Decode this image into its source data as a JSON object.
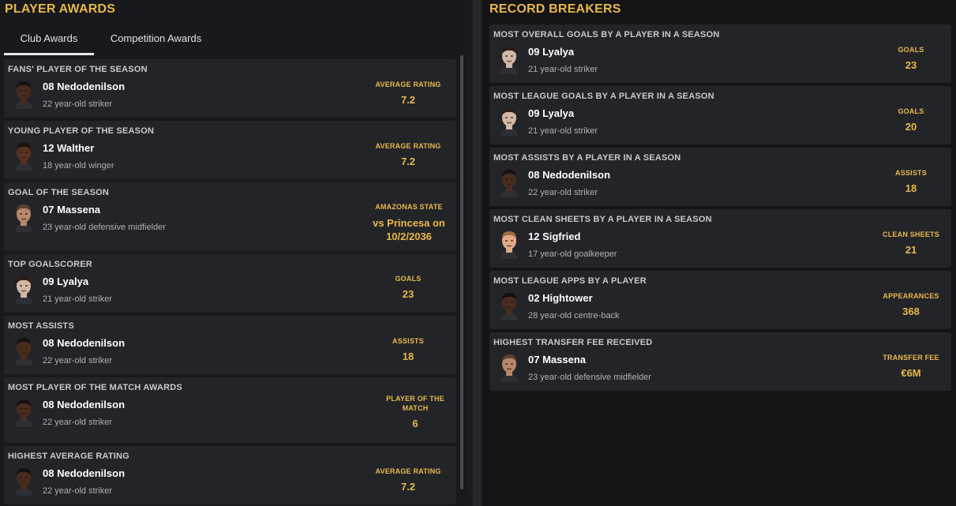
{
  "left": {
    "title": "PLAYER AWARDS",
    "tabs": [
      {
        "label": "Club Awards",
        "active": true
      },
      {
        "label": "Competition Awards",
        "active": false
      }
    ],
    "awards": [
      {
        "title": "FANS' PLAYER OF THE SEASON",
        "name": "08 Nedodenilson",
        "desc": "22 year-old striker",
        "stat_label": "AVERAGE RATING",
        "stat_value": "7.2",
        "skin": "#4a2c1e",
        "hair": "#151010"
      },
      {
        "title": "YOUNG PLAYER OF THE SEASON",
        "name": "12 Walther",
        "desc": "18 year-old winger",
        "stat_label": "AVERAGE RATING",
        "stat_value": "7.2",
        "skin": "#5a3220",
        "hair": "#1a1210"
      },
      {
        "title": "GOAL OF THE SEASON",
        "name": "07 Massena",
        "desc": "23 year-old defensive midfielder",
        "stat_label": "AMAZONAS STATE",
        "stat_value": "vs Princesa on 10/2/2036",
        "skin": "#b8876a",
        "hair": "#5a4030"
      },
      {
        "title": "TOP GOALSCORER",
        "name": "09 Lyalya",
        "desc": "21 year-old striker",
        "stat_label": "GOALS",
        "stat_value": "23",
        "skin": "#d2b7a4",
        "hair": "#2a1d18"
      },
      {
        "title": "MOST ASSISTS",
        "name": "08 Nedodenilson",
        "desc": "22 year-old striker",
        "stat_label": "ASSISTS",
        "stat_value": "18",
        "skin": "#4a2c1e",
        "hair": "#151010"
      },
      {
        "title": "MOST PLAYER OF THE MATCH AWARDS",
        "name": "08 Nedodenilson",
        "desc": "22 year-old striker",
        "stat_label": "PLAYER OF THE MATCH",
        "stat_value": "6",
        "skin": "#4a2c1e",
        "hair": "#151010"
      },
      {
        "title": "HIGHEST AVERAGE RATING",
        "name": "08 Nedodenilson",
        "desc": "22 year-old striker",
        "stat_label": "AVERAGE RATING",
        "stat_value": "7.2",
        "skin": "#4a2c1e",
        "hair": "#151010"
      }
    ]
  },
  "right": {
    "title": "RECORD BREAKERS",
    "records": [
      {
        "title": "MOST OVERALL GOALS BY A PLAYER IN A SEASON",
        "name": "09 Lyalya",
        "desc": "21 year-old striker",
        "stat_label": "GOALS",
        "stat_value": "23",
        "skin": "#d2b7a4",
        "hair": "#2a1d18"
      },
      {
        "title": "MOST LEAGUE GOALS BY A PLAYER IN A SEASON",
        "name": "09 Lyalya",
        "desc": "21 year-old striker",
        "stat_label": "GOALS",
        "stat_value": "20",
        "skin": "#d2b7a4",
        "hair": "#2a1d18"
      },
      {
        "title": "MOST ASSISTS BY A PLAYER IN A SEASON",
        "name": "08 Nedodenilson",
        "desc": "22 year-old striker",
        "stat_label": "ASSISTS",
        "stat_value": "18",
        "skin": "#4a2c1e",
        "hair": "#151010"
      },
      {
        "title": "MOST CLEAN SHEETS BY A PLAYER IN A SEASON",
        "name": "12 Sigfried",
        "desc": "17 year-old goalkeeper",
        "stat_label": "CLEAN SHEETS",
        "stat_value": "21",
        "skin": "#e0a888",
        "hair": "#a06a40"
      },
      {
        "title": "MOST LEAGUE APPS BY A PLAYER",
        "name": "02 Hightower",
        "desc": "28 year-old centre-back",
        "stat_label": "APPEARANCES",
        "stat_value": "368",
        "skin": "#4a2c1e",
        "hair": "#141010"
      },
      {
        "title": "HIGHEST TRANSFER FEE RECEIVED",
        "name": "07 Massena",
        "desc": "23 year-old defensive midfielder",
        "stat_label": "TRANSFER FEE",
        "stat_value": "€6M",
        "skin": "#b8876a",
        "hair": "#5a4030"
      }
    ]
  }
}
